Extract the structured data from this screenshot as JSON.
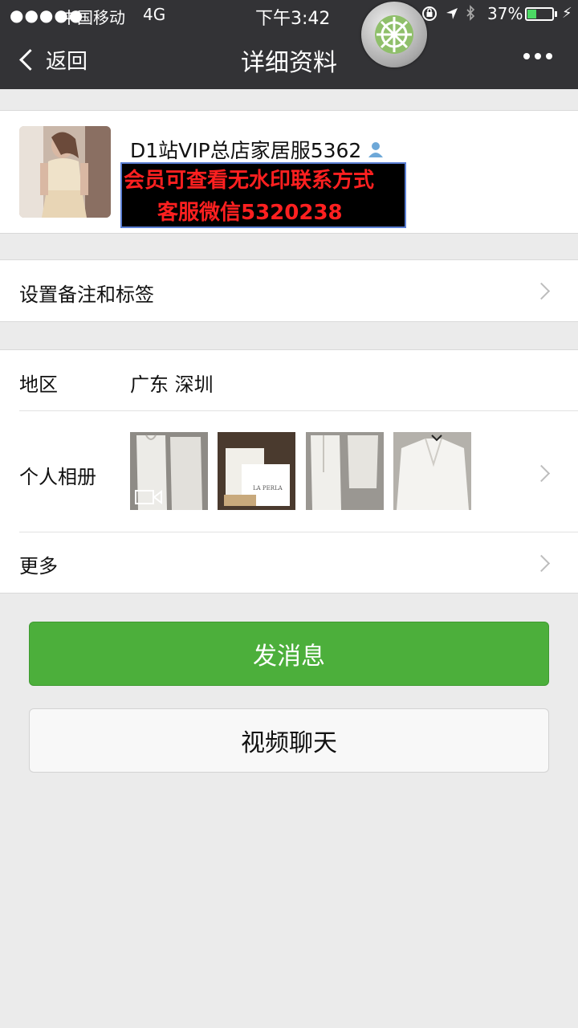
{
  "status_bar": {
    "signal": "●●●●●",
    "carrier": "中国移动",
    "network": "4G",
    "time": "下午3:42",
    "battery_percent": "37%",
    "battery_level": 0.37,
    "battery_color": "#4cd964"
  },
  "nav": {
    "back_label": "返回",
    "title": "详细资料"
  },
  "profile": {
    "nickname": "D1站VIP总店家居服5362",
    "promo_line1": "会员可查看无水印联系方式",
    "promo_line2": "客服微信5320238"
  },
  "rows": {
    "remark_label": "设置备注和标签",
    "region_label": "地区",
    "region_value": "广东 深圳",
    "album_label": "个人相册",
    "album_thumb_text": "LA PERLA",
    "more_label": "更多"
  },
  "buttons": {
    "send_message": "发消息",
    "video_call": "视频聊天"
  },
  "colors": {
    "nav_bg": "#333336",
    "primary_green": "#4caf3b",
    "page_bg": "#ebebeb",
    "promo_text": "#ff2020"
  }
}
